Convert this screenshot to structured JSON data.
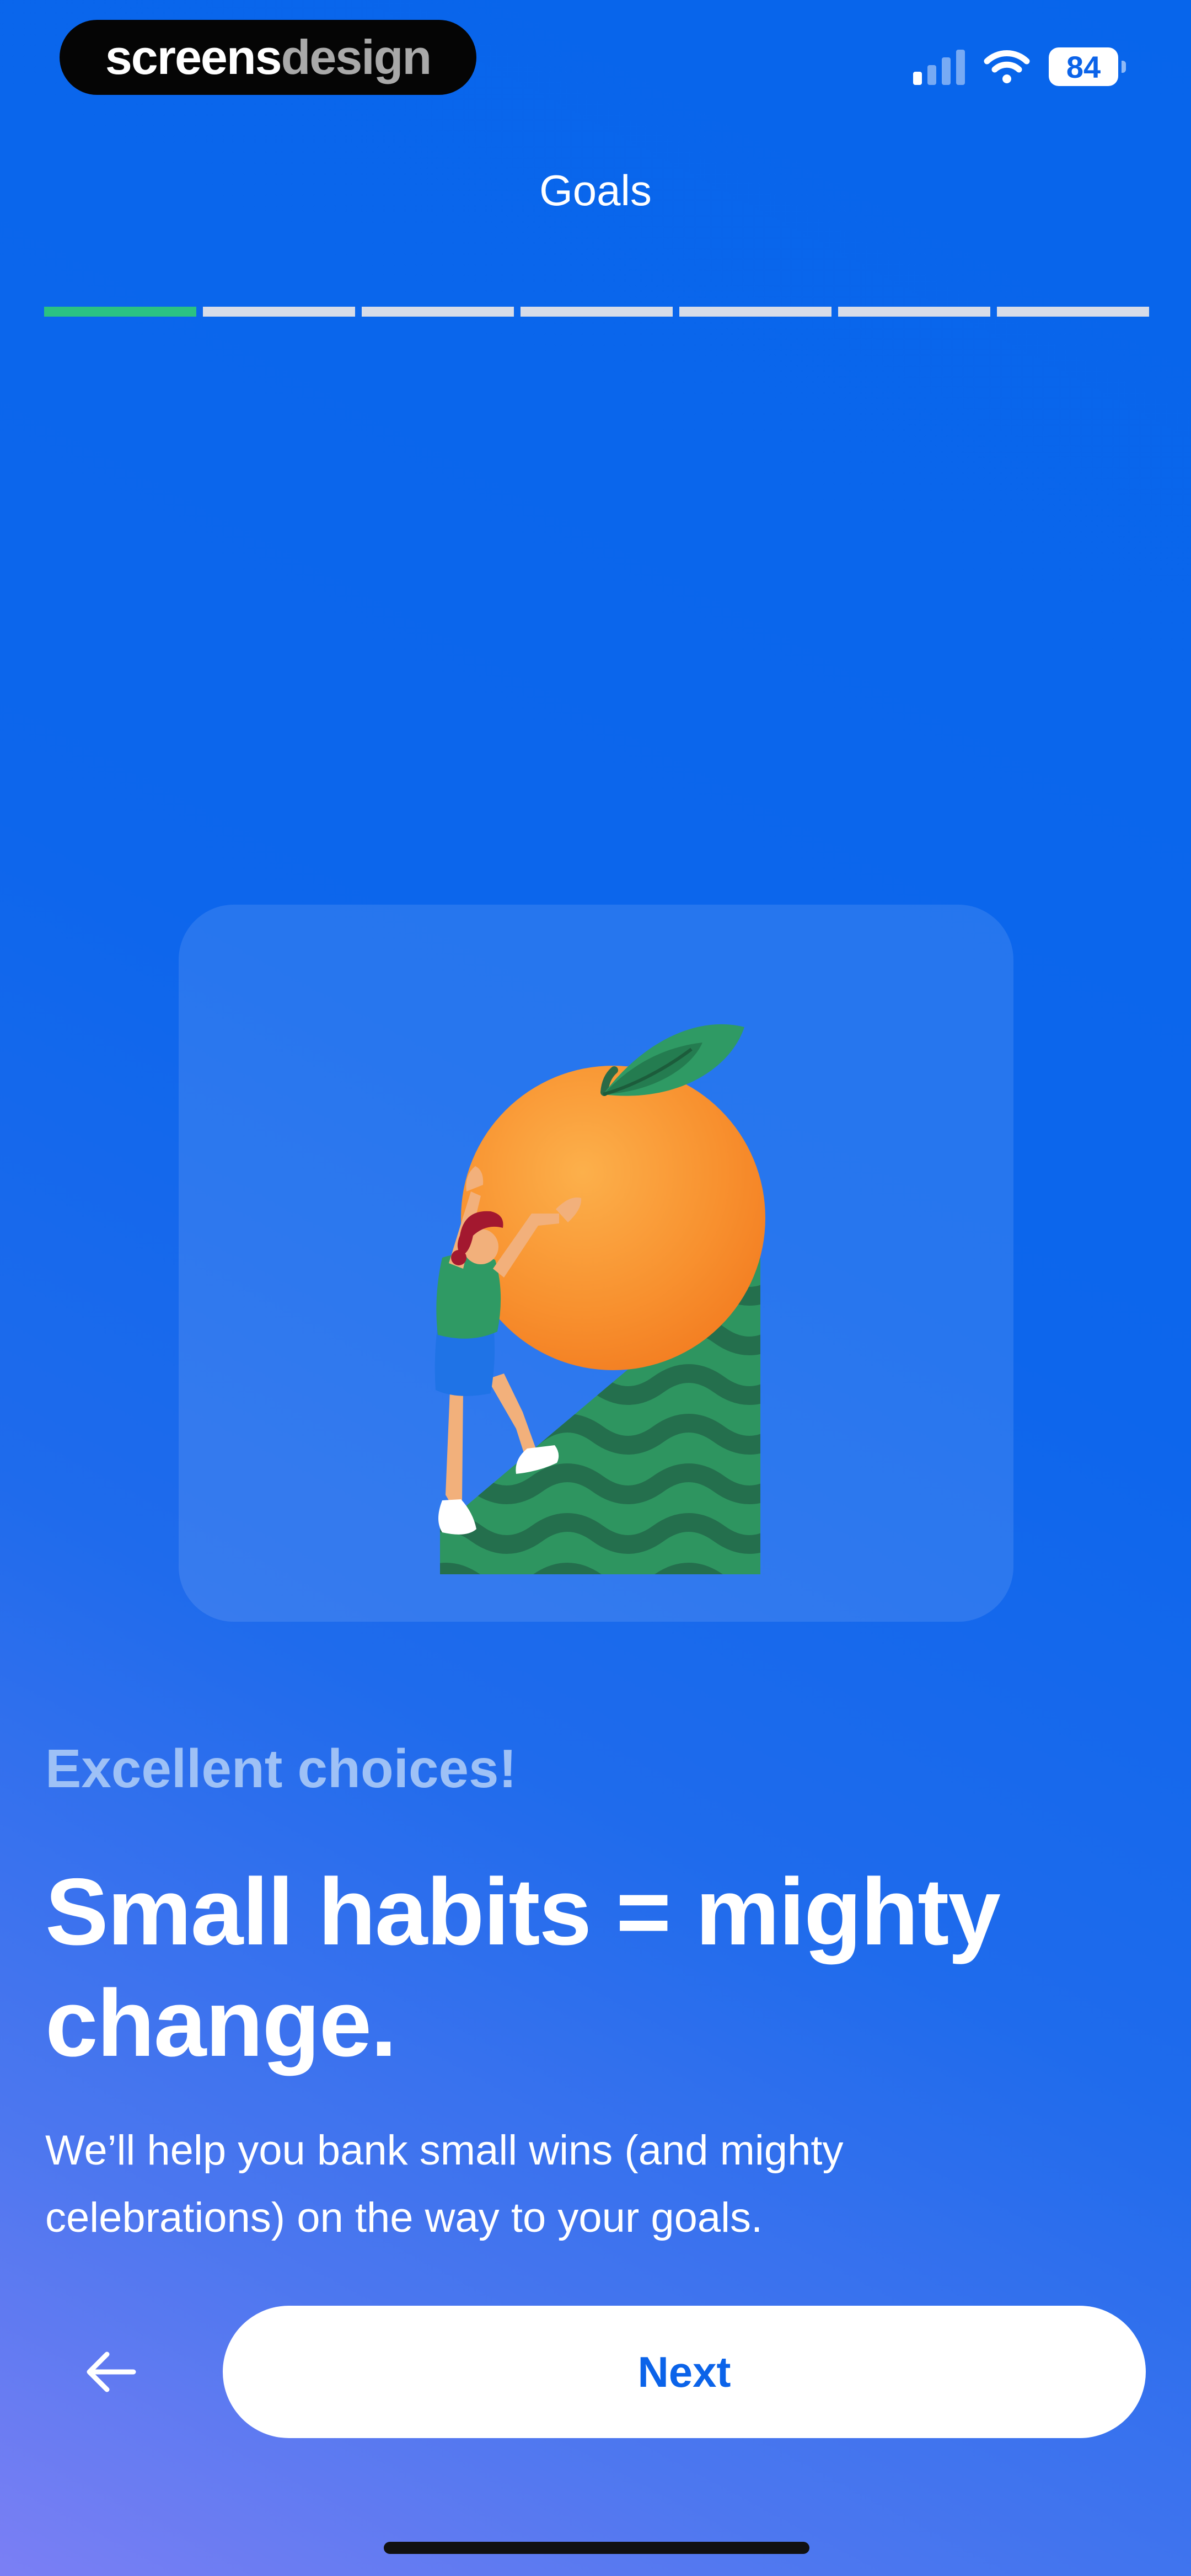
{
  "status_bar": {
    "brand_part1": "screens",
    "brand_part2": "design",
    "battery_level": "84",
    "signal_bars_filled": 1,
    "signal_bars_total": 4,
    "icons": [
      "cellular-signal-icon",
      "wifi-icon",
      "battery-icon"
    ]
  },
  "header": {
    "title": "Goals",
    "progress": {
      "total_steps": 7,
      "completed_steps": 1
    }
  },
  "illustration": {
    "name": "person-climbing-orange-illustration"
  },
  "content": {
    "eyebrow": "Excellent choices!",
    "headline": "Small habits = mighty change.",
    "body": "We’ll help you bank small wins (and mighty celebrations) on the way to your goals."
  },
  "footer": {
    "back_icon": "arrow-left-icon",
    "next_label": "Next"
  },
  "colors": {
    "background": "#0765eb",
    "accent_progress": "#2bc282",
    "progress_inactive": "#d7dce8",
    "eyebrow": "#9ec1f6",
    "button_text": "#0b63e9",
    "orange": "#f78b2c",
    "green": "#2e9560"
  }
}
